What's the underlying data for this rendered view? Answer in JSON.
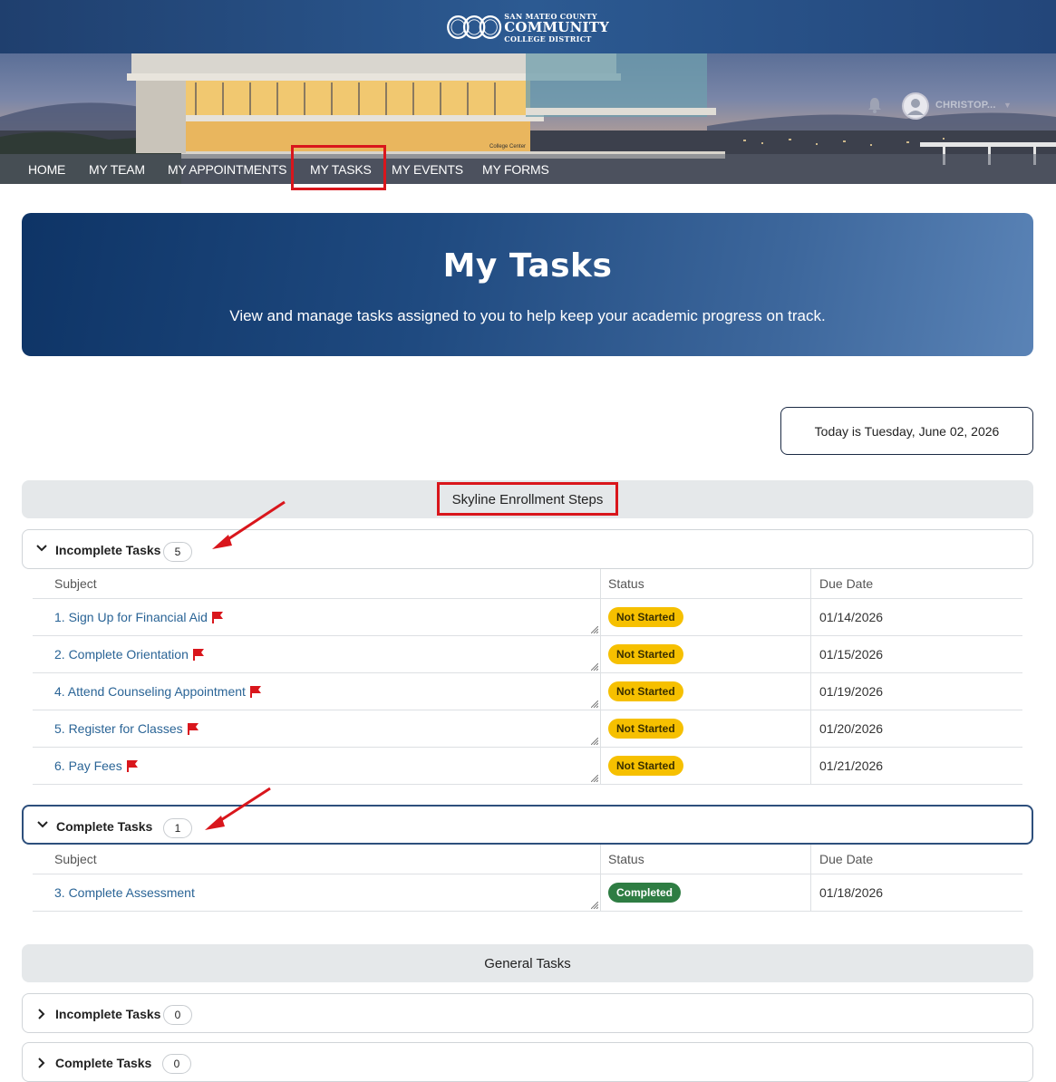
{
  "brand": {
    "line1": "SAN MATEO COUNTY",
    "line2": "COMMUNITY",
    "line3": "COLLEGE DISTRICT",
    "photo_caption": "College Center"
  },
  "user": {
    "name": "CHRISTOP..."
  },
  "nav": {
    "items": [
      "HOME",
      "MY TEAM",
      "MY APPOINTMENTS",
      "MY TASKS",
      "MY EVENTS",
      "MY FORMS"
    ],
    "active": "MY TASKS"
  },
  "header": {
    "title": "My Tasks",
    "subtitle": "View and manage tasks assigned to you to help keep your academic progress on track."
  },
  "today": "Today is Tuesday, June 02, 2026",
  "columns": {
    "subject": "Subject",
    "status": "Status",
    "due": "Due Date"
  },
  "sections": [
    {
      "title": "Skyline Enrollment Steps",
      "incomplete": {
        "label": "Incomplete Tasks",
        "count": "5",
        "rows": [
          {
            "subject": "1. Sign Up for Financial Aid",
            "status": "Not Started",
            "due": "01/14/2026"
          },
          {
            "subject": "2. Complete Orientation",
            "status": "Not Started",
            "due": "01/15/2026"
          },
          {
            "subject": "4. Attend Counseling Appointment",
            "status": "Not Started",
            "due": "01/19/2026"
          },
          {
            "subject": "5. Register for Classes",
            "status": "Not Started",
            "due": "01/20/2026"
          },
          {
            "subject": "6. Pay Fees",
            "status": "Not Started",
            "due": "01/21/2026"
          }
        ]
      },
      "complete": {
        "label": "Complete Tasks",
        "count": "1",
        "rows": [
          {
            "subject": "3. Complete Assessment",
            "status": "Completed",
            "due": "01/18/2026"
          }
        ]
      }
    },
    {
      "title": "General Tasks",
      "incomplete": {
        "label": "Incomplete Tasks",
        "count": "0"
      },
      "complete": {
        "label": "Complete Tasks",
        "count": "0"
      }
    }
  ],
  "colors": {
    "nav_highlight": "#d9161c",
    "badge_not_started": "#f6c000",
    "badge_completed": "#2e7d43",
    "link": "#2a6496",
    "flag": "#d9161c"
  },
  "icons": [
    "bell-icon",
    "user-avatar-icon",
    "chevron-down-icon",
    "chevron-right-icon",
    "flag-icon"
  ]
}
